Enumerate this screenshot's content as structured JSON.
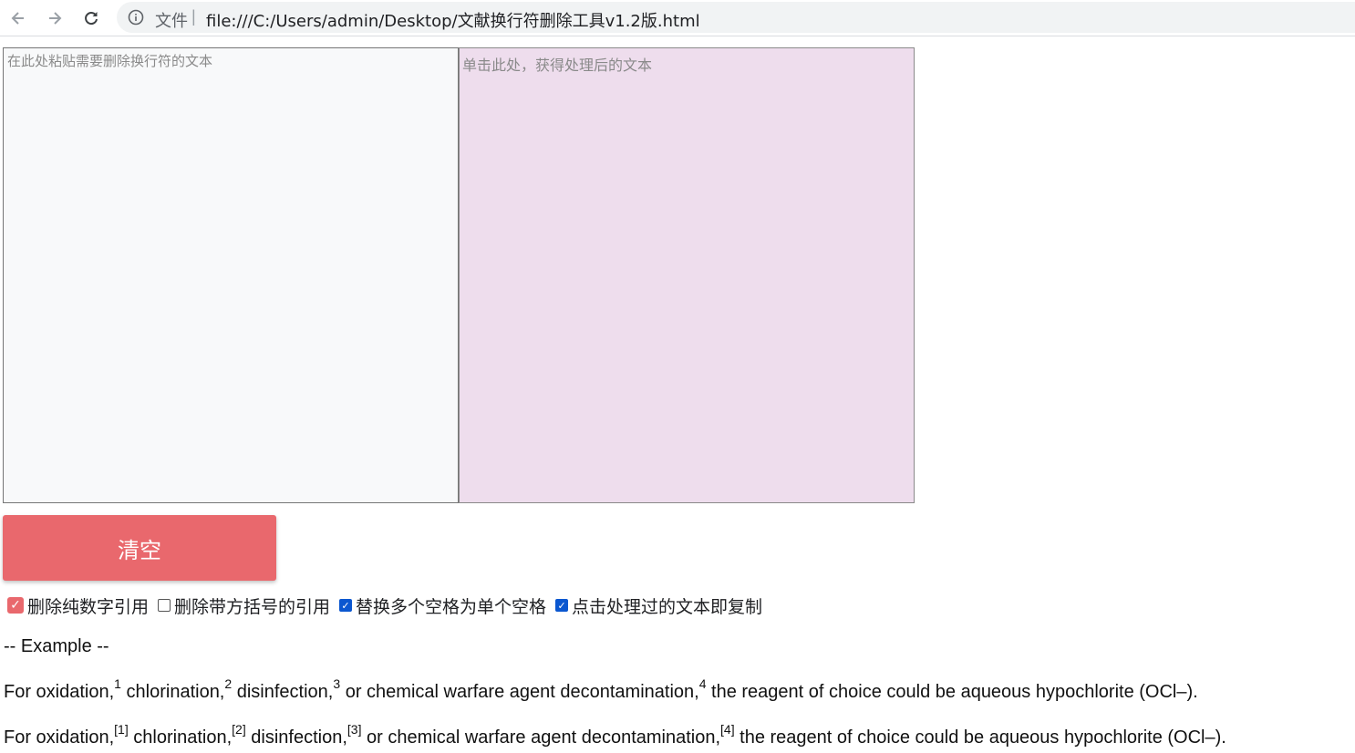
{
  "browser": {
    "protocol_label": "文件",
    "separator": "|",
    "url": "file:///C:/Users/admin/Desktop/文献换行符删除工具v1.2版.html"
  },
  "editor": {
    "input_placeholder": "在此处粘贴需要删除换行符的文本",
    "output_placeholder": "单击此处，获得处理后的文本"
  },
  "clear_button": {
    "label": "清空"
  },
  "options": [
    {
      "label": "删除纯数字引用",
      "checked": true
    },
    {
      "label": "删除带方括号的引用",
      "checked": false
    },
    {
      "label": "替换多个空格为单个空格",
      "checked": true
    },
    {
      "label": "点击处理过的文本即复制",
      "checked": true
    }
  ],
  "example": {
    "title": "-- Example --",
    "line1": {
      "t0": "For oxidation,",
      "s1": "1",
      "t1": " chlorination,",
      "s2": "2",
      "t2": " disinfection,",
      "s3": "3",
      "t3": " or chemical warfare agent decontamination,",
      "s4": "4",
      "t4": " the reagent of choice could be aqueous hypochlorite (OCl–)."
    },
    "line2": {
      "t0": "For oxidation,",
      "s1": "[1]",
      "t1": " chlorination,",
      "s2": "[2]",
      "t2": " disinfection,",
      "s3": "[3]",
      "t3": " or chemical warfare agent decontamination,",
      "s4": "[4]",
      "t4": " the reagent of choice could be aqueous hypochlorite (OCl–)."
    }
  },
  "colors": {
    "clear_button": "#e9686d",
    "output_background": "#eedded",
    "input_background": "#f8f9fa",
    "checkbox_checked": "#0b57d0"
  },
  "icons": {
    "back": "arrow-left-icon",
    "forward": "arrow-right-icon",
    "reload": "reload-icon",
    "info": "info-icon"
  }
}
